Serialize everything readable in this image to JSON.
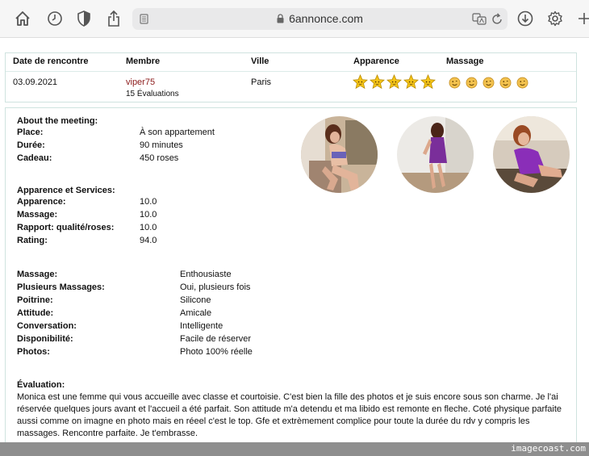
{
  "browser": {
    "url": "6annonce.com",
    "icons": [
      "home-icon",
      "history-icon",
      "shield-icon",
      "share-icon",
      "reader-icon",
      "lock-icon",
      "translate-icon",
      "reload-icon",
      "download-icon",
      "settings-icon",
      "new-tab-icon"
    ]
  },
  "summary": {
    "headers": {
      "date": "Date de rencontre",
      "member": "Membre",
      "city": "Ville",
      "appearance": "Apparence",
      "massage": "Massage"
    },
    "date": "03.09.2021",
    "member": "viper75",
    "member_reviews": "15 Évaluations",
    "city": "Paris",
    "appearance_stars": 5,
    "massage_smileys": 5,
    "colors": {
      "member": "#8b1a1a",
      "border": "#cfe3df"
    }
  },
  "meeting": {
    "heading": "About the meeting:",
    "place_label": "Place:",
    "place_value": "À son appartement",
    "duration_label": "Durée:",
    "duration_value": "90 minutes",
    "gift_label": "Cadeau:",
    "gift_value": "450 roses"
  },
  "services": {
    "heading": "Apparence et Services:",
    "rows": [
      {
        "label": "Apparence:",
        "value": "10.0"
      },
      {
        "label": "Massage:",
        "value": "10.0"
      },
      {
        "label": "Rapport: qualité/roses:",
        "value": "10.0"
      },
      {
        "label": "Rating:",
        "value": "94.0"
      }
    ]
  },
  "details": {
    "rows": [
      {
        "label": "Massage:",
        "value": "Enthousiaste"
      },
      {
        "label": "Plusieurs Massages:",
        "value": "Oui, plusieurs fois"
      },
      {
        "label": "Poitrine:",
        "value": "Silicone"
      },
      {
        "label": "Attitude:",
        "value": "Amicale"
      },
      {
        "label": "Conversation:",
        "value": "Intelligente"
      },
      {
        "label": "Disponibilité:",
        "value": "Facile de réserver"
      },
      {
        "label": "Photos:",
        "value": "Photo 100% réelle"
      }
    ]
  },
  "review": {
    "heading": "Évaluation:",
    "text": "Monica est une femme qui vous accueille avec classe et courtoisie. C'est bien la fille des photos et je suis encore sous son charme. Je l'ai réservée quelques jours avant et l'accueil a été parfait. Son attitude m'a detendu et ma libido est remonte en fleche. Coté physique parfaite aussi comme on imagne en photo mais en réeel c'est le top. Gfe et extrèmement complice pour toute la durée du rdv y compris les massages. Rencontre parfaite. Je t'embrasse."
  },
  "footer": {
    "watermark": "imagecoast.com"
  }
}
